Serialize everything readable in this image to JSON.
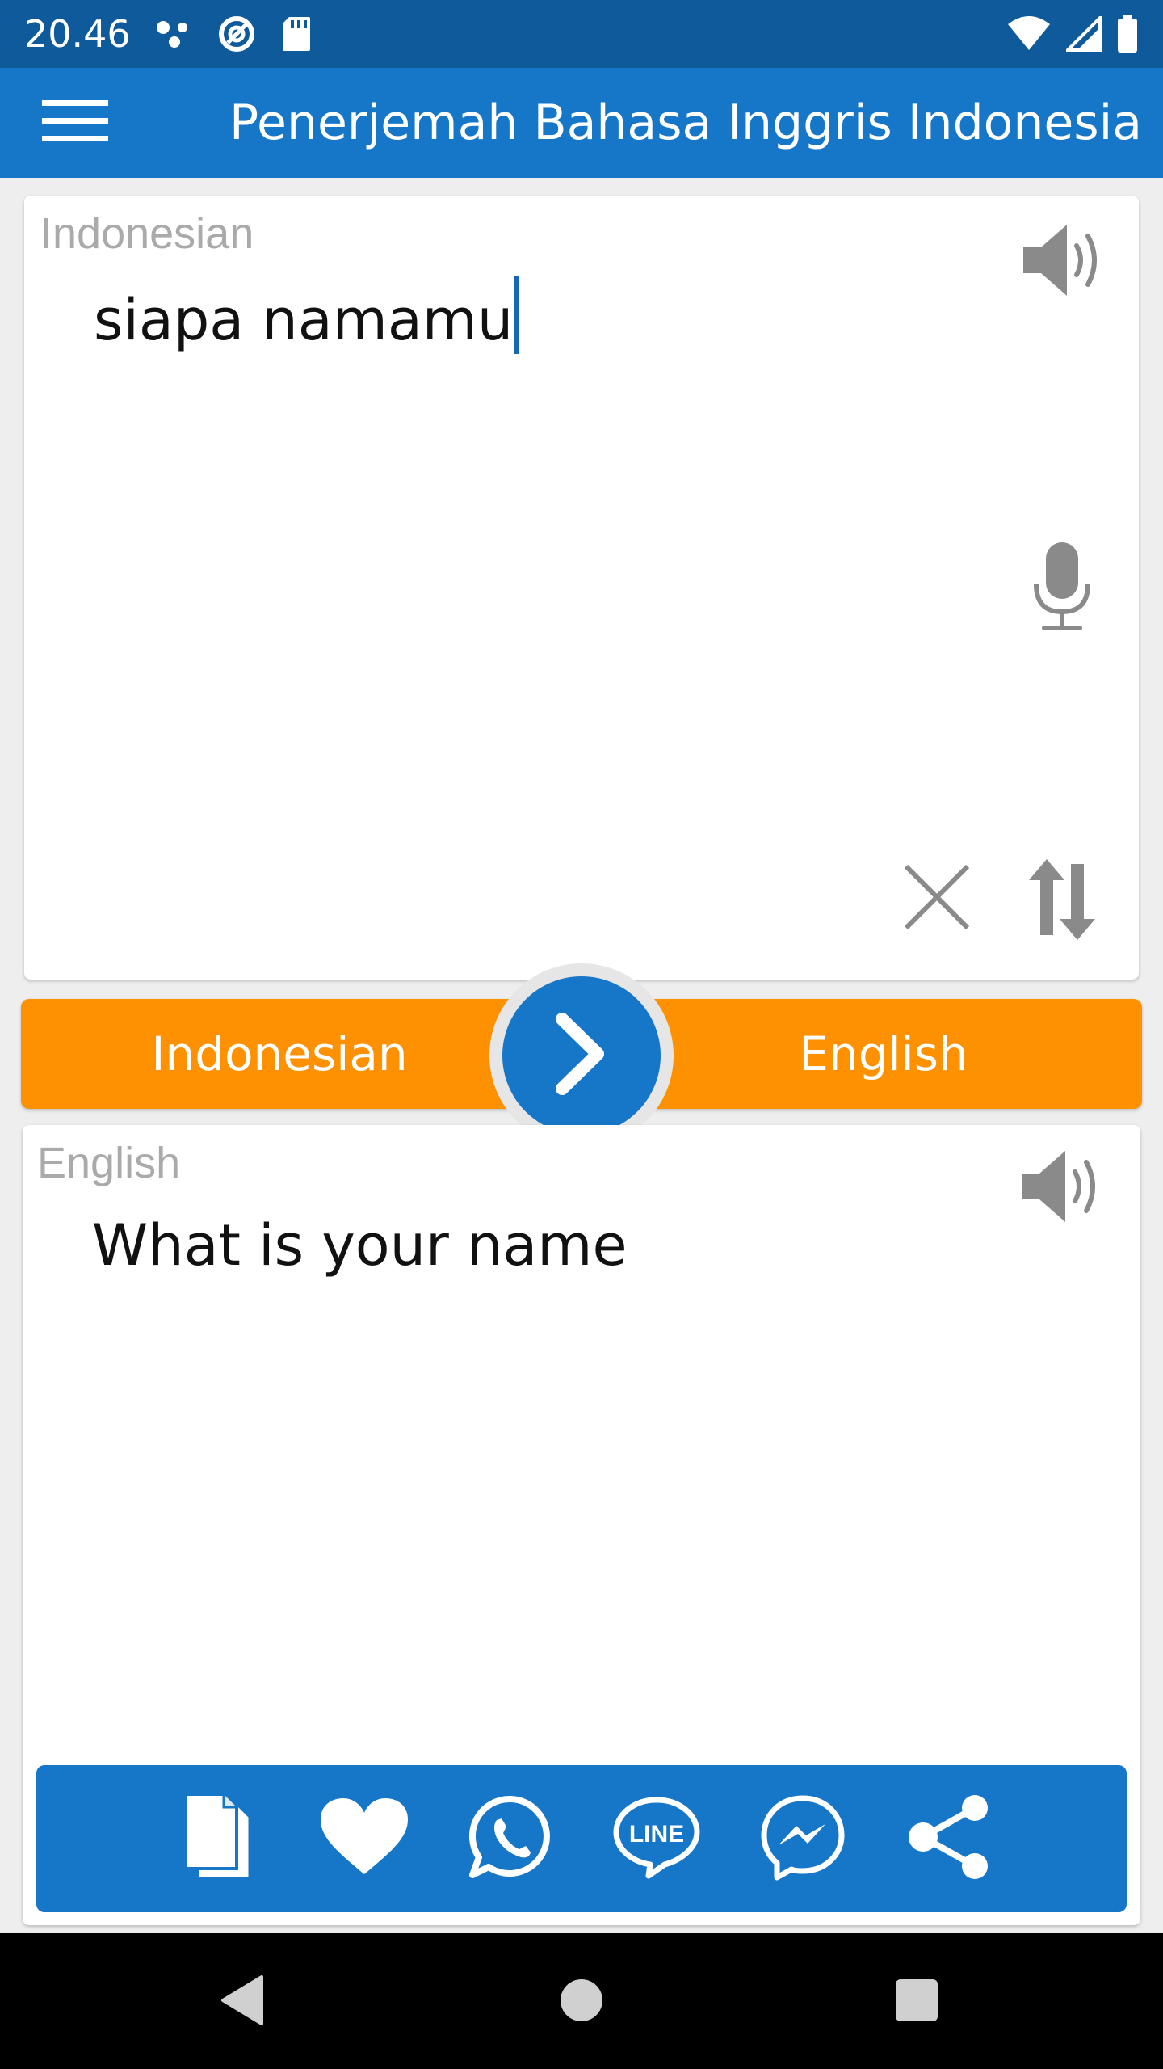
{
  "status_bar": {
    "time": "20.46"
  },
  "app_bar": {
    "title": "Penerjemah Bahasa Inggris Indonesia"
  },
  "source": {
    "label": "Indonesian",
    "text": "siapa namamu"
  },
  "language_bar": {
    "source_language": "Indonesian",
    "target_language": "English"
  },
  "target": {
    "label": "English",
    "text": "What is your name"
  },
  "colors": {
    "status_bar": "#0f5a9a",
    "primary": "#1677c8",
    "accent": "#fe9102",
    "icon_gray": "#8a8a8a",
    "label_gray": "#aaaaaa"
  },
  "actions": [
    "copy-icon",
    "heart-icon",
    "whatsapp-icon",
    "line-icon",
    "messenger-icon",
    "share-icon"
  ]
}
